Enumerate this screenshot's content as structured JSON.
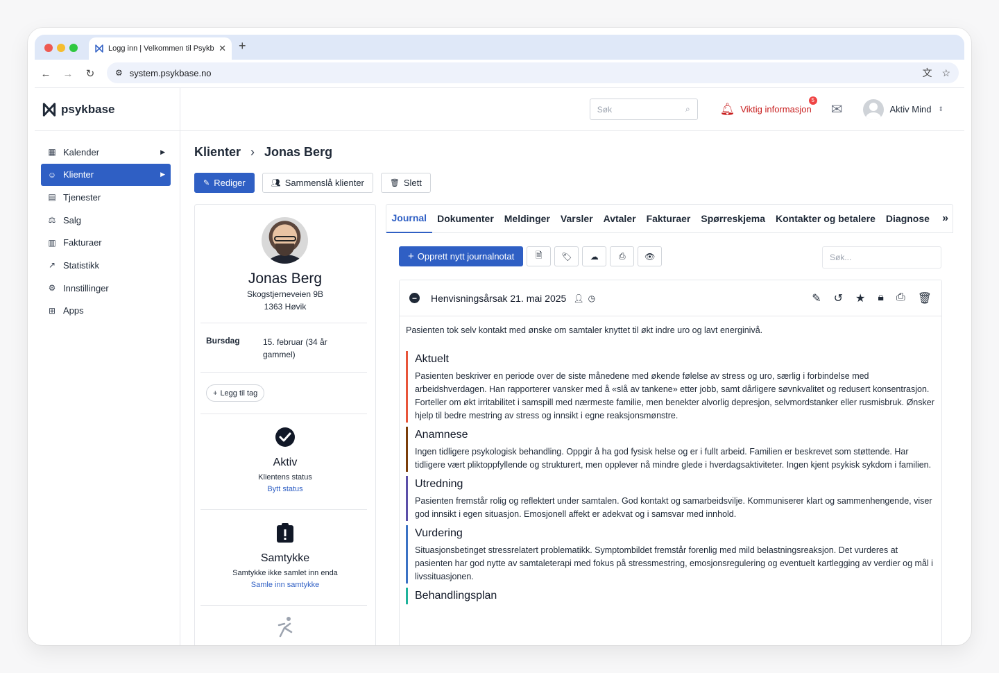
{
  "browser": {
    "tab_title": "Logg inn | Velkommen til Psykbase",
    "url": "system.psykbase.no"
  },
  "brand": {
    "name": "psykbase",
    "accent": "#2f5fc4"
  },
  "sidebar": {
    "items": [
      {
        "label": "Kalender",
        "icon": "calendar-icon"
      },
      {
        "label": "Klienter",
        "icon": "users-icon"
      },
      {
        "label": "Tjenester",
        "icon": "clipboard-icon"
      },
      {
        "label": "Salg",
        "icon": "scale-icon"
      },
      {
        "label": "Fakturaer",
        "icon": "invoice-icon"
      },
      {
        "label": "Statistikk",
        "icon": "chart-icon"
      },
      {
        "label": "Innstillinger",
        "icon": "gear-icon"
      },
      {
        "label": "Apps",
        "icon": "apps-icon"
      }
    ]
  },
  "topbar": {
    "search_placeholder": "Søk",
    "alert_label": "Viktig informasjon",
    "alert_count": "5",
    "user_name": "Aktiv Mind"
  },
  "breadcrumb": {
    "root": "Klienter",
    "current": "Jonas Berg"
  },
  "actions": {
    "edit": "Rediger",
    "merge": "Sammenslå klienter",
    "delete": "Slett"
  },
  "client": {
    "name": "Jonas Berg",
    "address_line1": "Skogstjerneveien 9B",
    "address_line2": "1363 Høvik",
    "birthday_label": "Bursdag",
    "birthday_value": "15. februar (34 år gammel)",
    "add_tag": "Legg til tag",
    "status": {
      "title": "Aktiv",
      "subtitle": "Klientens status",
      "link": "Bytt status"
    },
    "consent": {
      "title": "Samtykke",
      "subtitle": "Samtykke ikke samlet inn enda",
      "link": "Samle inn samtykke"
    }
  },
  "tabs": [
    "Journal",
    "Dokumenter",
    "Meldinger",
    "Varsler",
    "Avtaler",
    "Fakturaer",
    "Spørreskjema",
    "Kontakter og betalere",
    "Diagnose"
  ],
  "journal": {
    "new_note": "Opprett nytt journalnotat",
    "search_placeholder": "Søk...",
    "note_title": "Henvisningsårsak 21. mai 2025",
    "intro": "Pasienten tok selv kontakt med ønske om samtaler knyttet til økt indre uro og lavt energinivå.",
    "sections": [
      {
        "title": "Aktuelt",
        "color": "#e8553a",
        "text": "Pasienten beskriver en periode over de siste månedene med økende følelse av stress og uro, særlig i forbindelse med arbeidshverdagen. Han rapporterer vansker med å «slå av tankene» etter jobb, samt dårligere søvnkvalitet og redusert konsentrasjon. Forteller om økt irritabilitet i samspill med nærmeste familie, men benekter alvorlig depresjon, selvmordstanker eller rusmisbruk. Ønsker hjelp til bedre mestring av stress og innsikt i egne reaksjonsmønstre."
      },
      {
        "title": "Anamnese",
        "color": "#7a3d0a",
        "text": "Ingen tidligere psykologisk behandling. Oppgir å ha god fysisk helse og er i fullt arbeid. Familien er beskrevet som støttende. Har tidligere vært pliktoppfyllende og strukturert, men opplever nå mindre glede i hverdagsaktiviteter. Ingen kjent psykisk sykdom i familien."
      },
      {
        "title": "Utredning",
        "color": "#5b4fa8",
        "text": "Pasienten fremstår rolig og reflektert under samtalen. God kontakt og samarbeidsvilje. Kommuniserer klart og sammenhengende, viser god innsikt i egen situasjon. Emosjonell affekt er adekvat og i samsvar med innhold."
      },
      {
        "title": "Vurdering",
        "color": "#3b72c4",
        "text": "Situasjonsbetinget stressrelatert problematikk. Symptombildet fremstår forenlig med mild belastningsreaksjon. Det vurderes at pasienten har god nytte av samtaleterapi med fokus på stressmestring, emosjonsregulering og eventuelt kartlegging av verdier og mål i livssituasjonen."
      },
      {
        "title": "Behandlingsplan",
        "color": "#1fb39b",
        "text": ""
      }
    ]
  }
}
